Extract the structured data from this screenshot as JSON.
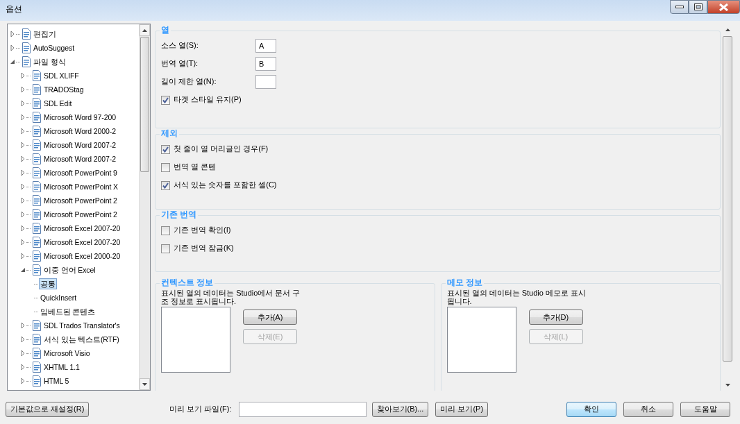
{
  "window": {
    "title": "옵션"
  },
  "tree": [
    {
      "label": "편집기",
      "expanded": false,
      "selected": false
    },
    {
      "label": "AutoSuggest",
      "expanded": false,
      "selected": false
    },
    {
      "label": "파일 형식",
      "expanded": true,
      "selected": false,
      "children": [
        {
          "label": "SDL XLIFF",
          "expanded": false,
          "selected": false
        },
        {
          "label": "TRADOStag",
          "expanded": false,
          "selected": false
        },
        {
          "label": "SDL Edit",
          "expanded": false,
          "selected": false
        },
        {
          "label": "Microsoft Word 97-200",
          "expanded": false,
          "selected": false
        },
        {
          "label": "Microsoft Word 2000-2",
          "expanded": false,
          "selected": false
        },
        {
          "label": "Microsoft Word 2007-2",
          "expanded": false,
          "selected": false
        },
        {
          "label": "Microsoft Word 2007-2",
          "expanded": false,
          "selected": false
        },
        {
          "label": "Microsoft PowerPoint 9",
          "expanded": false,
          "selected": false
        },
        {
          "label": "Microsoft PowerPoint X",
          "expanded": false,
          "selected": false
        },
        {
          "label": "Microsoft PowerPoint 2",
          "expanded": false,
          "selected": false
        },
        {
          "label": "Microsoft PowerPoint 2",
          "expanded": false,
          "selected": false
        },
        {
          "label": "Microsoft Excel 2007-20",
          "expanded": false,
          "selected": false
        },
        {
          "label": "Microsoft Excel 2007-20",
          "expanded": false,
          "selected": false
        },
        {
          "label": "Microsoft Excel 2000-20",
          "expanded": false,
          "selected": false
        },
        {
          "label": "이중 언어 Excel",
          "expanded": true,
          "selected": false,
          "children": [
            {
              "label": "공통",
              "selected": true
            },
            {
              "label": "QuickInsert",
              "selected": false
            },
            {
              "label": "임베드된 콘텐츠",
              "selected": false
            }
          ]
        },
        {
          "label": "SDL Trados Translator's",
          "expanded": false,
          "selected": false
        },
        {
          "label": "서식 있는 텍스트(RTF)",
          "expanded": false,
          "selected": false
        },
        {
          "label": "Microsoft Visio",
          "expanded": false,
          "selected": false
        },
        {
          "label": "XHTML 1.1",
          "expanded": false,
          "selected": false
        },
        {
          "label": "HTML 5",
          "expanded": false,
          "selected": false
        }
      ]
    }
  ],
  "columns_group": {
    "title": "열",
    "fields": [
      {
        "label": "소스 열(S):",
        "value": "A"
      },
      {
        "label": "번역 열(T):",
        "value": "B"
      },
      {
        "label": "길이 제한 열(N):"
      }
    ],
    "checkboxes": [
      {
        "label": "타겟 스타일 유지(P)",
        "checked": true
      }
    ]
  },
  "exclude_group": {
    "title": "제외",
    "checkboxes": [
      {
        "label": "첫 줄이 열 머리글인 경우(F)",
        "checked": true
      },
      {
        "label": "번역 열 콘텐",
        "checked": false
      },
      {
        "label": "서식 있는 숫자를 포함한 셀(C)",
        "checked": true
      }
    ]
  },
  "existing_group": {
    "title": "기존 번역",
    "checkboxes": [
      {
        "label": "기존 번역 확인(I)",
        "checked": false
      },
      {
        "label": "기존 번역 잠금(K)",
        "checked": false
      }
    ]
  },
  "info_groups": [
    {
      "title": "컨텍스트 정보",
      "description": "표시된 열의 데이터는 Studio에서 문서 구\n조 정보로 표시됩니다.",
      "buttons": [
        {
          "label": "추가(A)",
          "disabled": false
        },
        {
          "label": "삭제(E)",
          "disabled": true
        }
      ]
    },
    {
      "title": "메모 정보",
      "description": "표시된 열의 데이터는 Studio 메모로 표시\n됩니다.",
      "buttons": [
        {
          "label": "추가(D)",
          "disabled": false
        },
        {
          "label": "삭제(L)",
          "disabled": true
        }
      ]
    }
  ],
  "footer": {
    "reset_button": "기본값으로 재설정(R)",
    "preview_label": "미리 보기 파일(F):",
    "browse_button": "찾아보기(B)...",
    "preview_button": "미리 보기(P)",
    "buttons": [
      {
        "label": "확인",
        "default": true
      },
      {
        "label": "취소",
        "default": false
      },
      {
        "label": "도움말",
        "default": false
      }
    ]
  }
}
